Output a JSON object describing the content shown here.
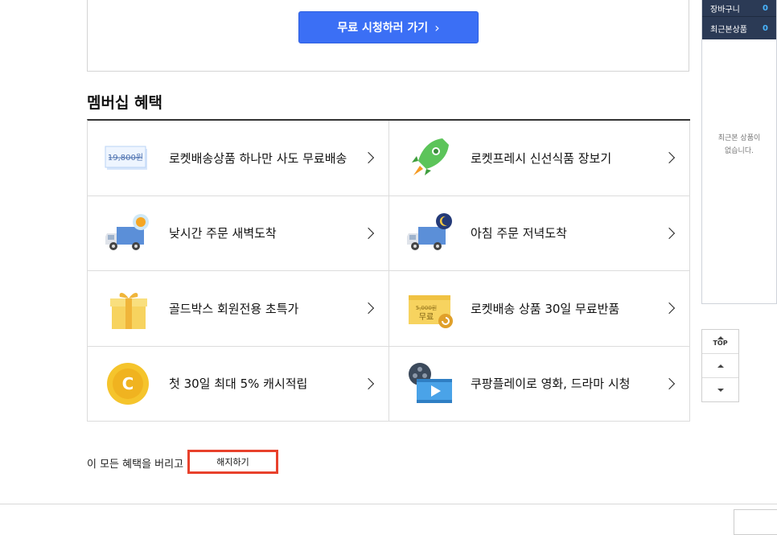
{
  "promo": {
    "cta_label": "무료 시청하러 가기"
  },
  "benefits": {
    "title": "멤버십 혜택",
    "items": [
      {
        "label": "로켓배송상품 하나만 사도 무료배송",
        "icon": "price-tag-icon",
        "icon_text": "19,800원"
      },
      {
        "label": "로켓프레시 신선식품 장보기",
        "icon": "rocket-icon"
      },
      {
        "label": "낮시간 주문 새벽도착",
        "icon": "truck-sun-icon"
      },
      {
        "label": "아침 주문 저녁도착",
        "icon": "truck-moon-icon"
      },
      {
        "label": "골드박스 회원전용 초특가",
        "icon": "gift-box-icon"
      },
      {
        "label": "로켓배송 상품 30일 무료반품",
        "icon": "return-box-icon",
        "icon_text_strike": "5,000원",
        "icon_text": "무료"
      },
      {
        "label": "첫 30일 최대 5% 캐시적립",
        "icon": "coin-icon",
        "icon_text": "C"
      },
      {
        "label": "쿠팡플레이로 영화, 드라마 시청",
        "icon": "movie-play-icon"
      }
    ]
  },
  "cancel": {
    "prompt": "이 모든 혜택을 버리고",
    "button_label": "해지하기"
  },
  "sidebar": {
    "cart_label": "장바구니",
    "cart_count": "0",
    "recent_label": "최근본상품",
    "recent_count": "0",
    "empty_line1": "최근본 상품이",
    "empty_line2": "없습니다."
  },
  "scroll_widget": {
    "top_label": "TOP"
  },
  "colors": {
    "accent": "#3b6ff5",
    "highlight": "#e8412c",
    "sidebar_bg": "#2b3a55"
  }
}
